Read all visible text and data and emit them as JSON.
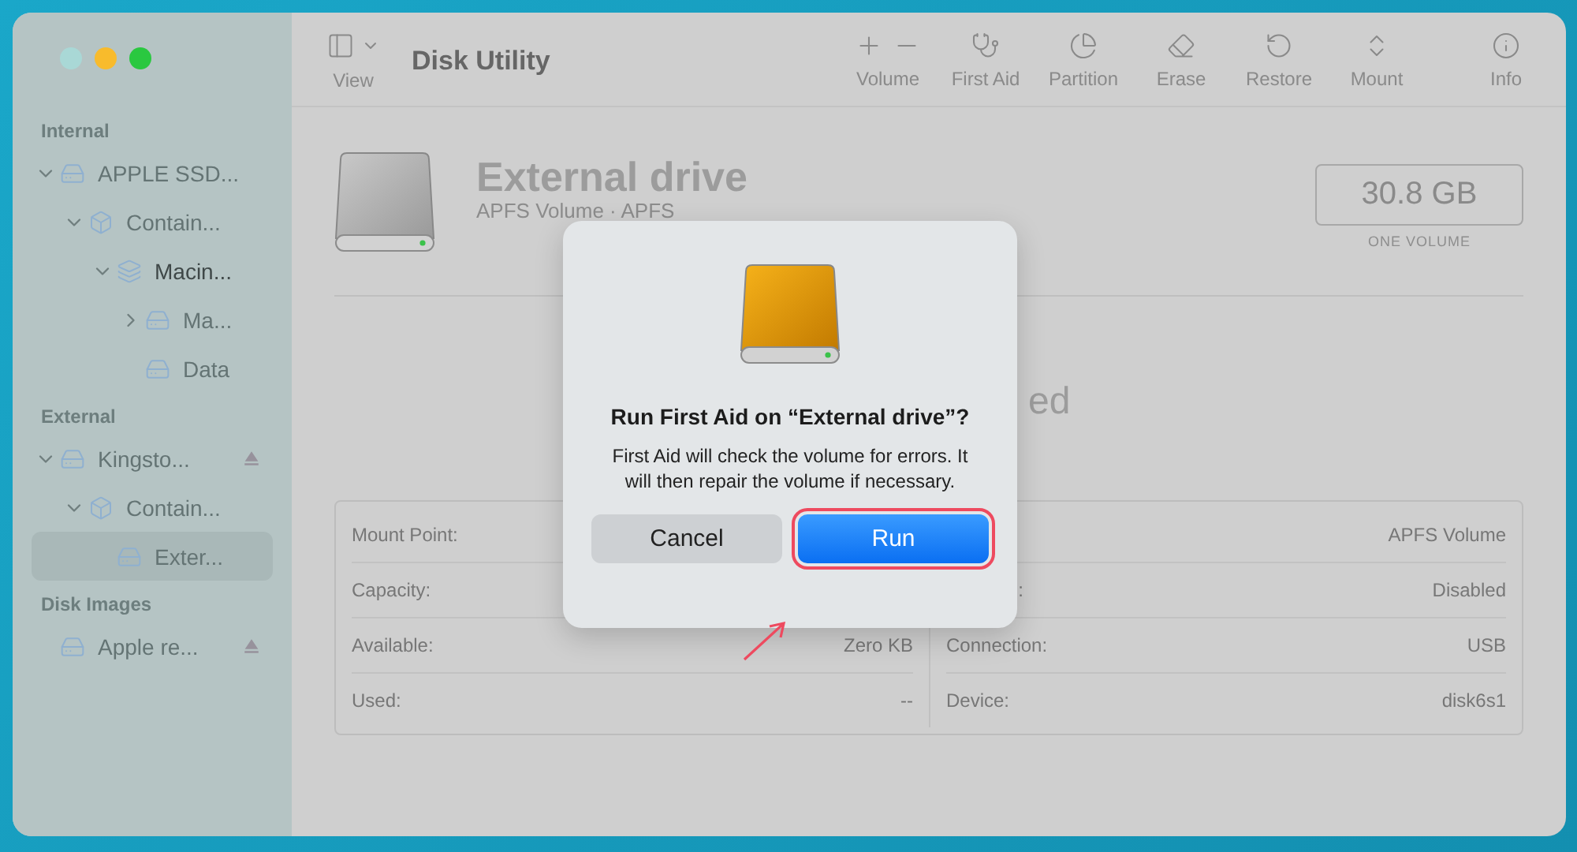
{
  "window": {
    "title": "Disk Utility"
  },
  "toolbar": {
    "view_label": "View",
    "items": [
      {
        "kind": "volume",
        "label": "Volume"
      },
      {
        "kind": "first_aid",
        "label": "First Aid"
      },
      {
        "kind": "partition",
        "label": "Partition"
      },
      {
        "kind": "erase",
        "label": "Erase"
      },
      {
        "kind": "restore",
        "label": "Restore"
      },
      {
        "kind": "mount",
        "label": "Mount"
      },
      {
        "kind": "info",
        "label": "Info"
      }
    ]
  },
  "sidebar": {
    "sections": [
      {
        "title": "Internal",
        "items": [
          {
            "label": "APPLE SSD...",
            "kind": "disk",
            "expanded": true,
            "selected": false,
            "dimmed": true,
            "ejectable": false,
            "children": [
              {
                "label": "Contain...",
                "kind": "container",
                "expanded": true,
                "selected": false,
                "dimmed": true,
                "ejectable": false,
                "children": [
                  {
                    "label": "Macin...",
                    "kind": "stack",
                    "expanded": true,
                    "selected": false,
                    "dimmed": false,
                    "ejectable": false,
                    "children": [
                      {
                        "label": "Ma...",
                        "kind": "disk",
                        "expanded": false,
                        "selected": false,
                        "dimmed": true,
                        "ejectable": false
                      },
                      {
                        "label": "Data",
                        "kind": "disk",
                        "selected": false,
                        "dimmed": true,
                        "ejectable": false
                      }
                    ]
                  }
                ]
              }
            ]
          }
        ]
      },
      {
        "title": "External",
        "items": [
          {
            "label": "Kingsto...",
            "kind": "disk",
            "expanded": true,
            "selected": false,
            "dimmed": true,
            "ejectable": true,
            "children": [
              {
                "label": "Contain...",
                "kind": "container",
                "expanded": true,
                "selected": false,
                "dimmed": true,
                "ejectable": false,
                "children": [
                  {
                    "label": "Exter...",
                    "kind": "disk",
                    "selected": true,
                    "dimmed": true,
                    "ejectable": false
                  }
                ]
              }
            ]
          }
        ]
      },
      {
        "title": "Disk Images",
        "items": [
          {
            "label": "Apple re...",
            "kind": "disk",
            "selected": false,
            "dimmed": true,
            "ejectable": true
          }
        ]
      }
    ]
  },
  "volume": {
    "name": "External drive",
    "subtitle": "APFS Volume · APFS",
    "size": "30.8 GB",
    "size_caption": "ONE VOLUME",
    "status_fragment": "ed"
  },
  "info_table": {
    "left": [
      {
        "label": "Mount Point:"
      },
      {
        "label": "Capacity:"
      },
      {
        "label": "Available:",
        "value": "Zero KB"
      },
      {
        "label": "Used:",
        "value": "--"
      }
    ],
    "right": [
      {
        "value": "APFS Volume"
      },
      {
        "label": ":",
        "kind": "fragment",
        "value": "Disabled"
      },
      {
        "label": "Connection:",
        "value": "USB"
      },
      {
        "label": "Device:",
        "value": "disk6s1"
      }
    ]
  },
  "dialog": {
    "title": "Run First Aid on “External drive”?",
    "message": "First Aid will check the volume for errors. It will then repair the volume if necessary.",
    "buttons": [
      {
        "label": "Cancel",
        "kind": "cancel",
        "highlighted": false
      },
      {
        "label": "Run",
        "kind": "default",
        "highlighted": true
      }
    ]
  }
}
